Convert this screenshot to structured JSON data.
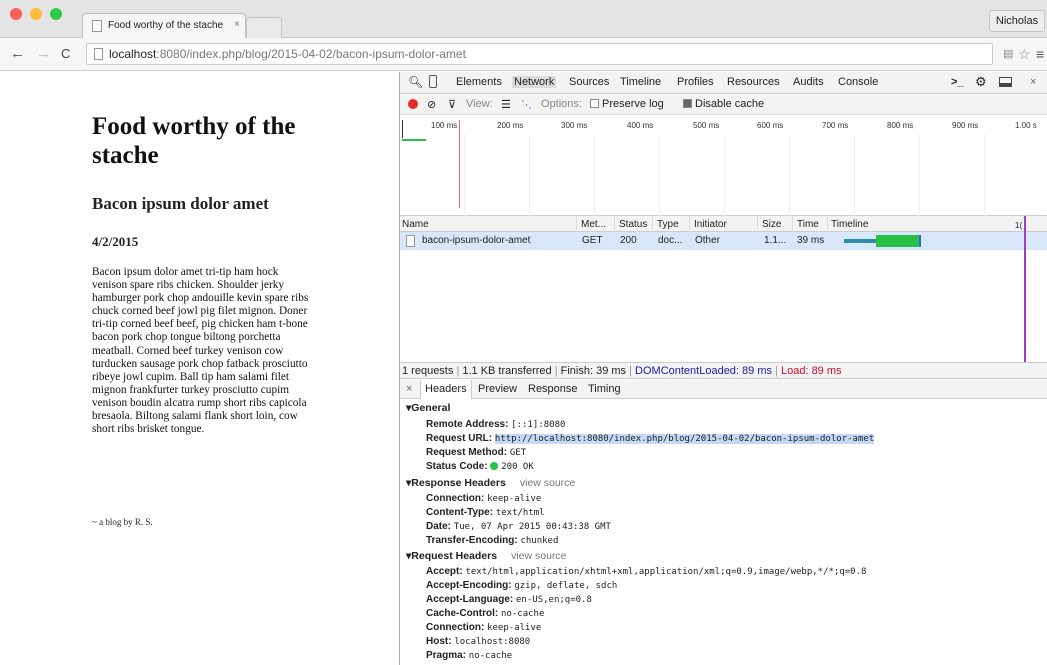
{
  "window": {
    "tab_title": "Food worthy of the stache",
    "tab_close": "×",
    "profile_name": "Nicholas",
    "url_host": "localhost",
    "url_rest": ":8080/index.php/blog/2015-04-02/bacon-ipsum-dolor-amet"
  },
  "page": {
    "site_title": "Food worthy of the stache",
    "post_title": "Bacon ipsum dolor amet",
    "date": "4/2/2015",
    "body": "Bacon ipsum dolor amet tri-tip ham hock venison spare ribs chicken. Shoulder jerky hamburger pork chop andouille kevin spare ribs chuck corned beef jowl pig filet mignon. Doner tri-tip corned beef beef, pig chicken ham t-bone bacon pork chop tongue biltong porchetta meatball. Corned beef turkey venison cow turducken sausage pork chop fatback prosciutto ribeye jowl cupim. Ball tip ham salami filet mignon frankfurter turkey prosciutto cupim venison boudin alcatra rump short ribs capicola bresaola. Biltong salami flank short loin, cow short ribs brisket tongue.",
    "signature": "~ a blog by R. S."
  },
  "devtools": {
    "tabs": [
      "Elements",
      "Network",
      "Sources",
      "Timeline",
      "Profiles",
      "Resources",
      "Audits",
      "Console"
    ],
    "active_tab": "Network",
    "toolbar": {
      "view_label": "View:",
      "options_label": "Options:",
      "preserve_log": "Preserve log",
      "preserve_log_checked": false,
      "disable_cache": "Disable cache",
      "disable_cache_checked": true
    },
    "overview_ticks": [
      "100 ms",
      "200 ms",
      "300 ms",
      "400 ms",
      "500 ms",
      "600 ms",
      "700 ms",
      "800 ms",
      "900 ms",
      "1.00 s"
    ],
    "table_headers": {
      "name": "Name",
      "method": "Met...",
      "status": "Status",
      "type": "Type",
      "initiator": "Initiator",
      "size": "Size",
      "time": "Time",
      "timeline": "Timeline",
      "timeline_tick": "1("
    },
    "request": {
      "name": "bacon-ipsum-dolor-amet",
      "method": "GET",
      "status": "200",
      "type": "doc...",
      "initiator": "Other",
      "size": "1.1...",
      "time": "39 ms"
    },
    "summary": {
      "requests": "1 requests",
      "transferred": "1.1 KB transferred",
      "finish": "Finish: 39 ms",
      "dom_loaded": "DOMContentLoaded: 89 ms",
      "load": "Load: 89 ms",
      "sep": "|"
    },
    "detail_tabs": {
      "close": "×",
      "headers": "Headers",
      "preview": "Preview",
      "response": "Response",
      "timing": "Timing"
    },
    "general": {
      "title": "▾General",
      "remote_address_k": "Remote Address:",
      "remote_address_v": "[::1]:8080",
      "request_url_k": "Request URL:",
      "request_url_v": "http://localhost:8080/index.php/blog/2015-04-02/bacon-ipsum-dolor-amet",
      "request_method_k": "Request Method:",
      "request_method_v": "GET",
      "status_code_k": "Status Code:",
      "status_code_v": "200 OK"
    },
    "response_headers": {
      "title": "▾Response Headers",
      "view_source": "view source",
      "items": [
        {
          "k": "Connection:",
          "v": "keep-alive"
        },
        {
          "k": "Content-Type:",
          "v": "text/html"
        },
        {
          "k": "Date:",
          "v": "Tue, 07 Apr 2015 00:43:38 GMT"
        },
        {
          "k": "Transfer-Encoding:",
          "v": "chunked"
        }
      ]
    },
    "request_headers": {
      "title": "▾Request Headers",
      "view_source": "view source",
      "items": [
        {
          "k": "Accept:",
          "v": "text/html,application/xhtml+xml,application/xml;q=0.9,image/webp,*/*;q=0.8"
        },
        {
          "k": "Accept-Encoding:",
          "v": "gzip, deflate, sdch"
        },
        {
          "k": "Accept-Language:",
          "v": "en-US,en;q=0.8"
        },
        {
          "k": "Cache-Control:",
          "v": "no-cache"
        },
        {
          "k": "Connection:",
          "v": "keep-alive"
        },
        {
          "k": "Host:",
          "v": "localhost:8080"
        },
        {
          "k": "Pragma:",
          "v": "no-cache"
        }
      ]
    }
  },
  "colors": {
    "traffic_red": "#fc605b",
    "traffic_yellow": "#fdbc40",
    "traffic_green": "#34c84a",
    "selected_row": "#d9e7fb",
    "dom_loaded": "#1a1aa6",
    "load": "#c8102e",
    "waterfall_blue": "#2b8ea6",
    "waterfall_green": "#28c046"
  }
}
